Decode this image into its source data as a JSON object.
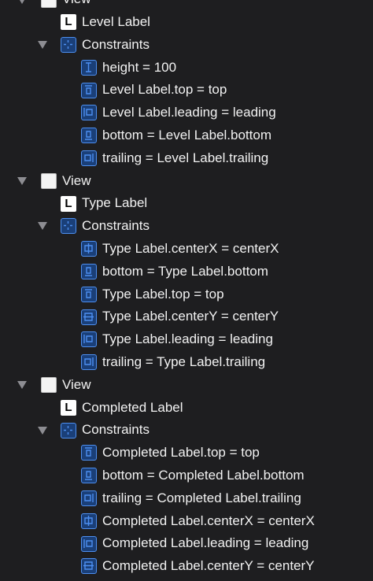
{
  "outline": [
    {
      "kind": "view",
      "depth": 0,
      "label": "View",
      "expanded": true,
      "icon": "view-icon"
    },
    {
      "kind": "label",
      "depth": 1,
      "label": "Level Label",
      "icon": "label-icon"
    },
    {
      "kind": "group",
      "depth": 1,
      "label": "Constraints",
      "expanded": true,
      "icon": "constraints-group-icon"
    },
    {
      "kind": "constraint",
      "depth": 2,
      "label": "height = 100",
      "icon": "height-constraint-icon"
    },
    {
      "kind": "constraint",
      "depth": 2,
      "label": "Level Label.top = top",
      "icon": "top-constraint-icon"
    },
    {
      "kind": "constraint",
      "depth": 2,
      "label": "Level Label.leading = leading",
      "icon": "leading-constraint-icon"
    },
    {
      "kind": "constraint",
      "depth": 2,
      "label": "bottom = Level Label.bottom",
      "icon": "bottom-constraint-icon"
    },
    {
      "kind": "constraint",
      "depth": 2,
      "label": "trailing = Level Label.trailing",
      "icon": "trailing-constraint-icon"
    },
    {
      "kind": "view",
      "depth": 0,
      "label": "View",
      "expanded": true,
      "icon": "view-icon"
    },
    {
      "kind": "label",
      "depth": 1,
      "label": "Type Label",
      "icon": "label-icon"
    },
    {
      "kind": "group",
      "depth": 1,
      "label": "Constraints",
      "expanded": true,
      "icon": "constraints-group-icon"
    },
    {
      "kind": "constraint",
      "depth": 2,
      "label": "Type Label.centerX = centerX",
      "icon": "centerx-constraint-icon"
    },
    {
      "kind": "constraint",
      "depth": 2,
      "label": "bottom = Type Label.bottom",
      "icon": "bottom-constraint-icon"
    },
    {
      "kind": "constraint",
      "depth": 2,
      "label": "Type Label.top = top",
      "icon": "top-constraint-icon"
    },
    {
      "kind": "constraint",
      "depth": 2,
      "label": "Type Label.centerY = centerY",
      "icon": "centery-constraint-icon"
    },
    {
      "kind": "constraint",
      "depth": 2,
      "label": "Type Label.leading = leading",
      "icon": "leading-constraint-icon"
    },
    {
      "kind": "constraint",
      "depth": 2,
      "label": "trailing = Type Label.trailing",
      "icon": "trailing-constraint-icon"
    },
    {
      "kind": "view",
      "depth": 0,
      "label": "View",
      "expanded": true,
      "icon": "view-icon"
    },
    {
      "kind": "label",
      "depth": 1,
      "label": "Completed Label",
      "icon": "label-icon"
    },
    {
      "kind": "group",
      "depth": 1,
      "label": "Constraints",
      "expanded": true,
      "icon": "constraints-group-icon"
    },
    {
      "kind": "constraint",
      "depth": 2,
      "label": "Completed Label.top = top",
      "icon": "top-constraint-icon"
    },
    {
      "kind": "constraint",
      "depth": 2,
      "label": "bottom = Completed Label.bottom",
      "icon": "bottom-constraint-icon"
    },
    {
      "kind": "constraint",
      "depth": 2,
      "label": "trailing = Completed Label.trailing",
      "icon": "trailing-constraint-icon"
    },
    {
      "kind": "constraint",
      "depth": 2,
      "label": "Completed Label.centerX = centerX",
      "icon": "centerx-constraint-icon"
    },
    {
      "kind": "constraint",
      "depth": 2,
      "label": "Completed Label.leading = leading",
      "icon": "leading-constraint-icon"
    },
    {
      "kind": "constraint",
      "depth": 2,
      "label": "Completed Label.centerY = centerY",
      "icon": "centery-constraint-icon"
    }
  ],
  "colors": {
    "background": "#1e1e20",
    "text": "#f2f2f2",
    "disclosure": "#8d8d92",
    "constraint_icon_fill": "#1a3f78",
    "constraint_icon_stroke": "#4d8ff0"
  }
}
